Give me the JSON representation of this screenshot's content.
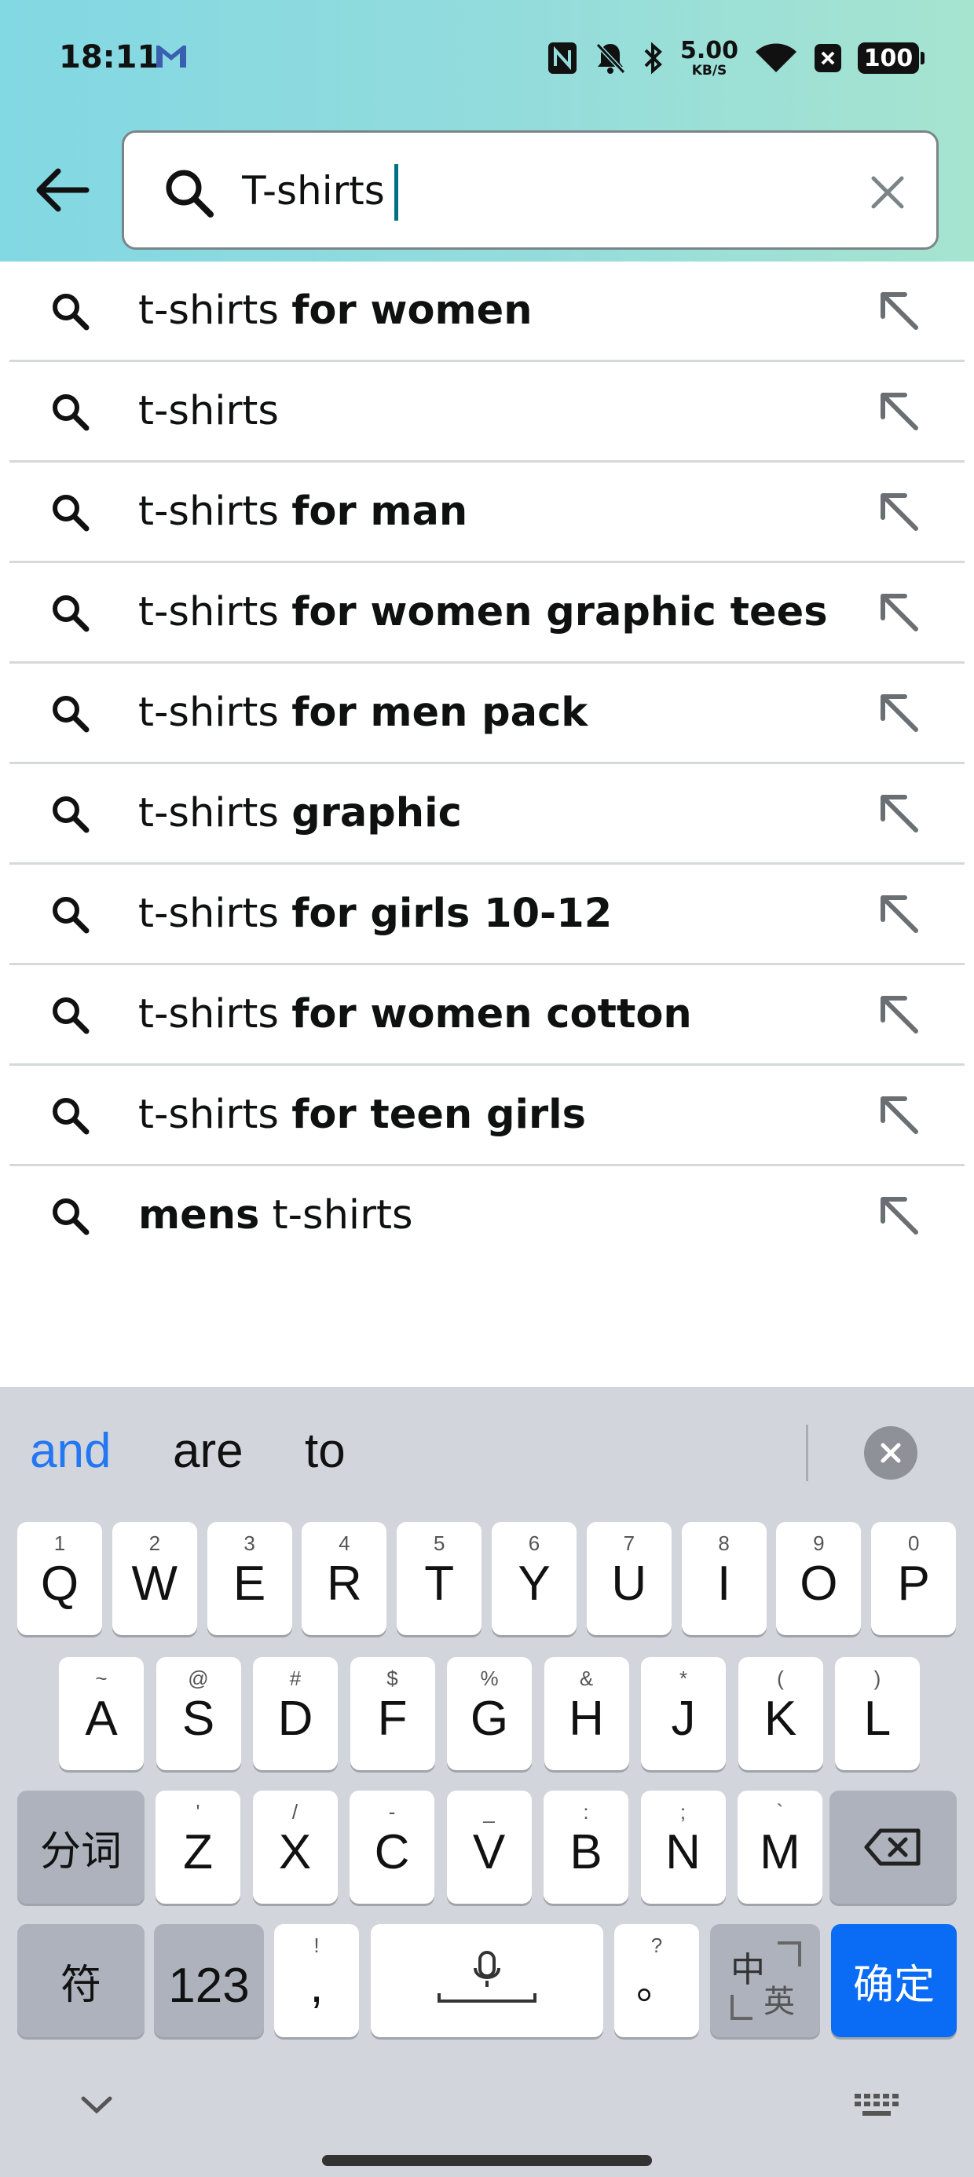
{
  "status_bar": {
    "time": "18:11",
    "net_speed_value": "5.00",
    "net_speed_unit": "KB/S",
    "battery": "100",
    "icons": [
      "gmail-icon",
      "nfc-icon",
      "bell-off-icon",
      "bluetooth-icon",
      "wifi-icon",
      "close-notification-icon",
      "battery-icon"
    ]
  },
  "search": {
    "value": "T-shirts",
    "back_icon": "arrow-left-icon",
    "search_icon": "search-icon",
    "clear_icon": "close-icon"
  },
  "suggestions": [
    {
      "normal": "t-shirts ",
      "bold": "for women",
      "bold_first": false
    },
    {
      "normal": "t-shirts",
      "bold": "",
      "bold_first": false
    },
    {
      "normal": "t-shirts ",
      "bold": "for man",
      "bold_first": false
    },
    {
      "normal": "t-shirts ",
      "bold": "for women graphic tees",
      "bold_first": false
    },
    {
      "normal": "t-shirts ",
      "bold": "for men pack",
      "bold_first": false
    },
    {
      "normal": "t-shirts ",
      "bold": "graphic",
      "bold_first": false
    },
    {
      "normal": "t-shirts ",
      "bold": "for girls 10-12",
      "bold_first": false
    },
    {
      "normal": "t-shirts ",
      "bold": "for women cotton",
      "bold_first": false
    },
    {
      "normal": "t-shirts ",
      "bold": "for teen girls",
      "bold_first": false
    },
    {
      "normal": " t-shirts",
      "bold": "mens",
      "bold_first": true
    }
  ],
  "keyboard": {
    "candidates": [
      "and",
      "are",
      "to"
    ],
    "row1": [
      [
        "Q",
        "1"
      ],
      [
        "W",
        "2"
      ],
      [
        "E",
        "3"
      ],
      [
        "R",
        "4"
      ],
      [
        "T",
        "5"
      ],
      [
        "Y",
        "6"
      ],
      [
        "U",
        "7"
      ],
      [
        "I",
        "8"
      ],
      [
        "O",
        "9"
      ],
      [
        "P",
        "0"
      ]
    ],
    "row2": [
      [
        "A",
        "~"
      ],
      [
        "S",
        "@"
      ],
      [
        "D",
        "#"
      ],
      [
        "F",
        "$"
      ],
      [
        "G",
        "%"
      ],
      [
        "H",
        "&"
      ],
      [
        "J",
        "*"
      ],
      [
        "K",
        "("
      ],
      [
        "L",
        ")"
      ]
    ],
    "row3_left": "分词",
    "row3": [
      [
        "Z",
        "'"
      ],
      [
        "X",
        "/"
      ],
      [
        "C",
        "-"
      ],
      [
        "V",
        "_"
      ],
      [
        "B",
        ":"
      ],
      [
        "N",
        ";"
      ],
      [
        "M",
        "`"
      ]
    ],
    "row4_symbols": "符",
    "row4_numbers": "123",
    "row4_comma": ",",
    "row4_comma_hint": "!",
    "row4_period": "。",
    "row4_period_hint": "?",
    "row4_lang_primary": "中",
    "row4_lang_secondary": "英",
    "row4_confirm": "确定",
    "colors": {
      "background": "#d2d5dc",
      "confirm": "#0a6cf5",
      "candidate_primary": "#2477f2"
    }
  }
}
